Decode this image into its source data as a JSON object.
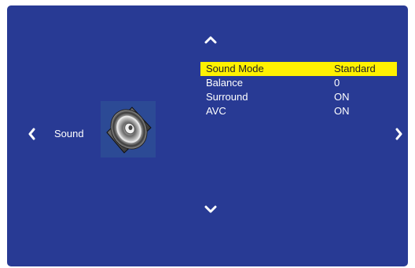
{
  "category": {
    "label": "Sound",
    "icon": "speaker-icon"
  },
  "navigation": {
    "up_icon": "chevron-up-icon",
    "down_icon": "chevron-down-icon",
    "left_icon": "chevron-left-icon",
    "right_icon": "chevron-right-icon"
  },
  "menu": {
    "items": [
      {
        "label": "Sound Mode",
        "value": "Standard",
        "selected": true
      },
      {
        "label": "Balance",
        "value": "0",
        "selected": false
      },
      {
        "label": "Surround",
        "value": "ON",
        "selected": false
      },
      {
        "label": "AVC",
        "value": "ON",
        "selected": false
      }
    ]
  },
  "colors": {
    "background": "#283a94",
    "highlight": "#fff100",
    "text": "#ffffff"
  }
}
